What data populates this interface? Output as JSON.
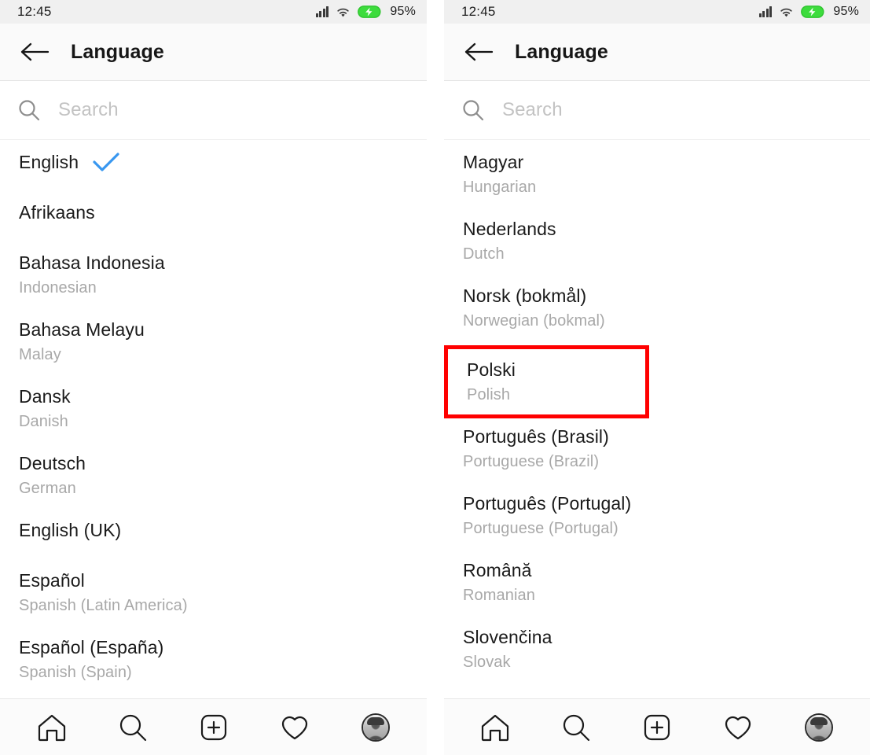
{
  "status_bar": {
    "time": "12:45",
    "battery_percent": "95%",
    "icons": [
      "signal-icon",
      "wifi-icon",
      "battery-charging-icon"
    ],
    "battery_color": "#3ddc3d"
  },
  "header": {
    "title": "Language",
    "back_icon": "back-arrow-icon"
  },
  "search": {
    "placeholder": "Search",
    "value": "",
    "icon": "search-icon"
  },
  "accent": {
    "check_blue": "#3897f0",
    "highlight_red": "#ff0000"
  },
  "left_panel": {
    "languages": [
      {
        "name": "English",
        "subtitle": "",
        "selected": true
      },
      {
        "name": "Afrikaans",
        "subtitle": "",
        "selected": false
      },
      {
        "name": "Bahasa Indonesia",
        "subtitle": "Indonesian",
        "selected": false
      },
      {
        "name": "Bahasa Melayu",
        "subtitle": "Malay",
        "selected": false
      },
      {
        "name": "Dansk",
        "subtitle": "Danish",
        "selected": false
      },
      {
        "name": "Deutsch",
        "subtitle": "German",
        "selected": false
      },
      {
        "name": "English (UK)",
        "subtitle": "",
        "selected": false
      },
      {
        "name": "Español",
        "subtitle": "Spanish (Latin America)",
        "selected": false
      },
      {
        "name": "Español (España)",
        "subtitle": "Spanish (Spain)",
        "selected": false
      }
    ]
  },
  "right_panel": {
    "languages": [
      {
        "name": "Magyar",
        "subtitle": "Hungarian",
        "highlighted": false
      },
      {
        "name": "Nederlands",
        "subtitle": "Dutch",
        "highlighted": false
      },
      {
        "name": "Norsk (bokmål)",
        "subtitle": "Norwegian (bokmal)",
        "highlighted": false
      },
      {
        "name": "Polski",
        "subtitle": "Polish",
        "highlighted": true
      },
      {
        "name": "Português (Brasil)",
        "subtitle": "Portuguese (Brazil)",
        "highlighted": false
      },
      {
        "name": "Português (Portugal)",
        "subtitle": "Portuguese (Portugal)",
        "highlighted": false
      },
      {
        "name": "Română",
        "subtitle": "Romanian",
        "highlighted": false
      },
      {
        "name": "Slovenčina",
        "subtitle": "Slovak",
        "highlighted": false
      }
    ]
  },
  "bottom_nav": {
    "items": [
      {
        "icon": "home-icon",
        "label": "Home"
      },
      {
        "icon": "search-icon",
        "label": "Search"
      },
      {
        "icon": "plus-square-icon",
        "label": "Create"
      },
      {
        "icon": "heart-icon",
        "label": "Activity"
      },
      {
        "icon": "profile-avatar-icon",
        "label": "Profile"
      }
    ]
  }
}
